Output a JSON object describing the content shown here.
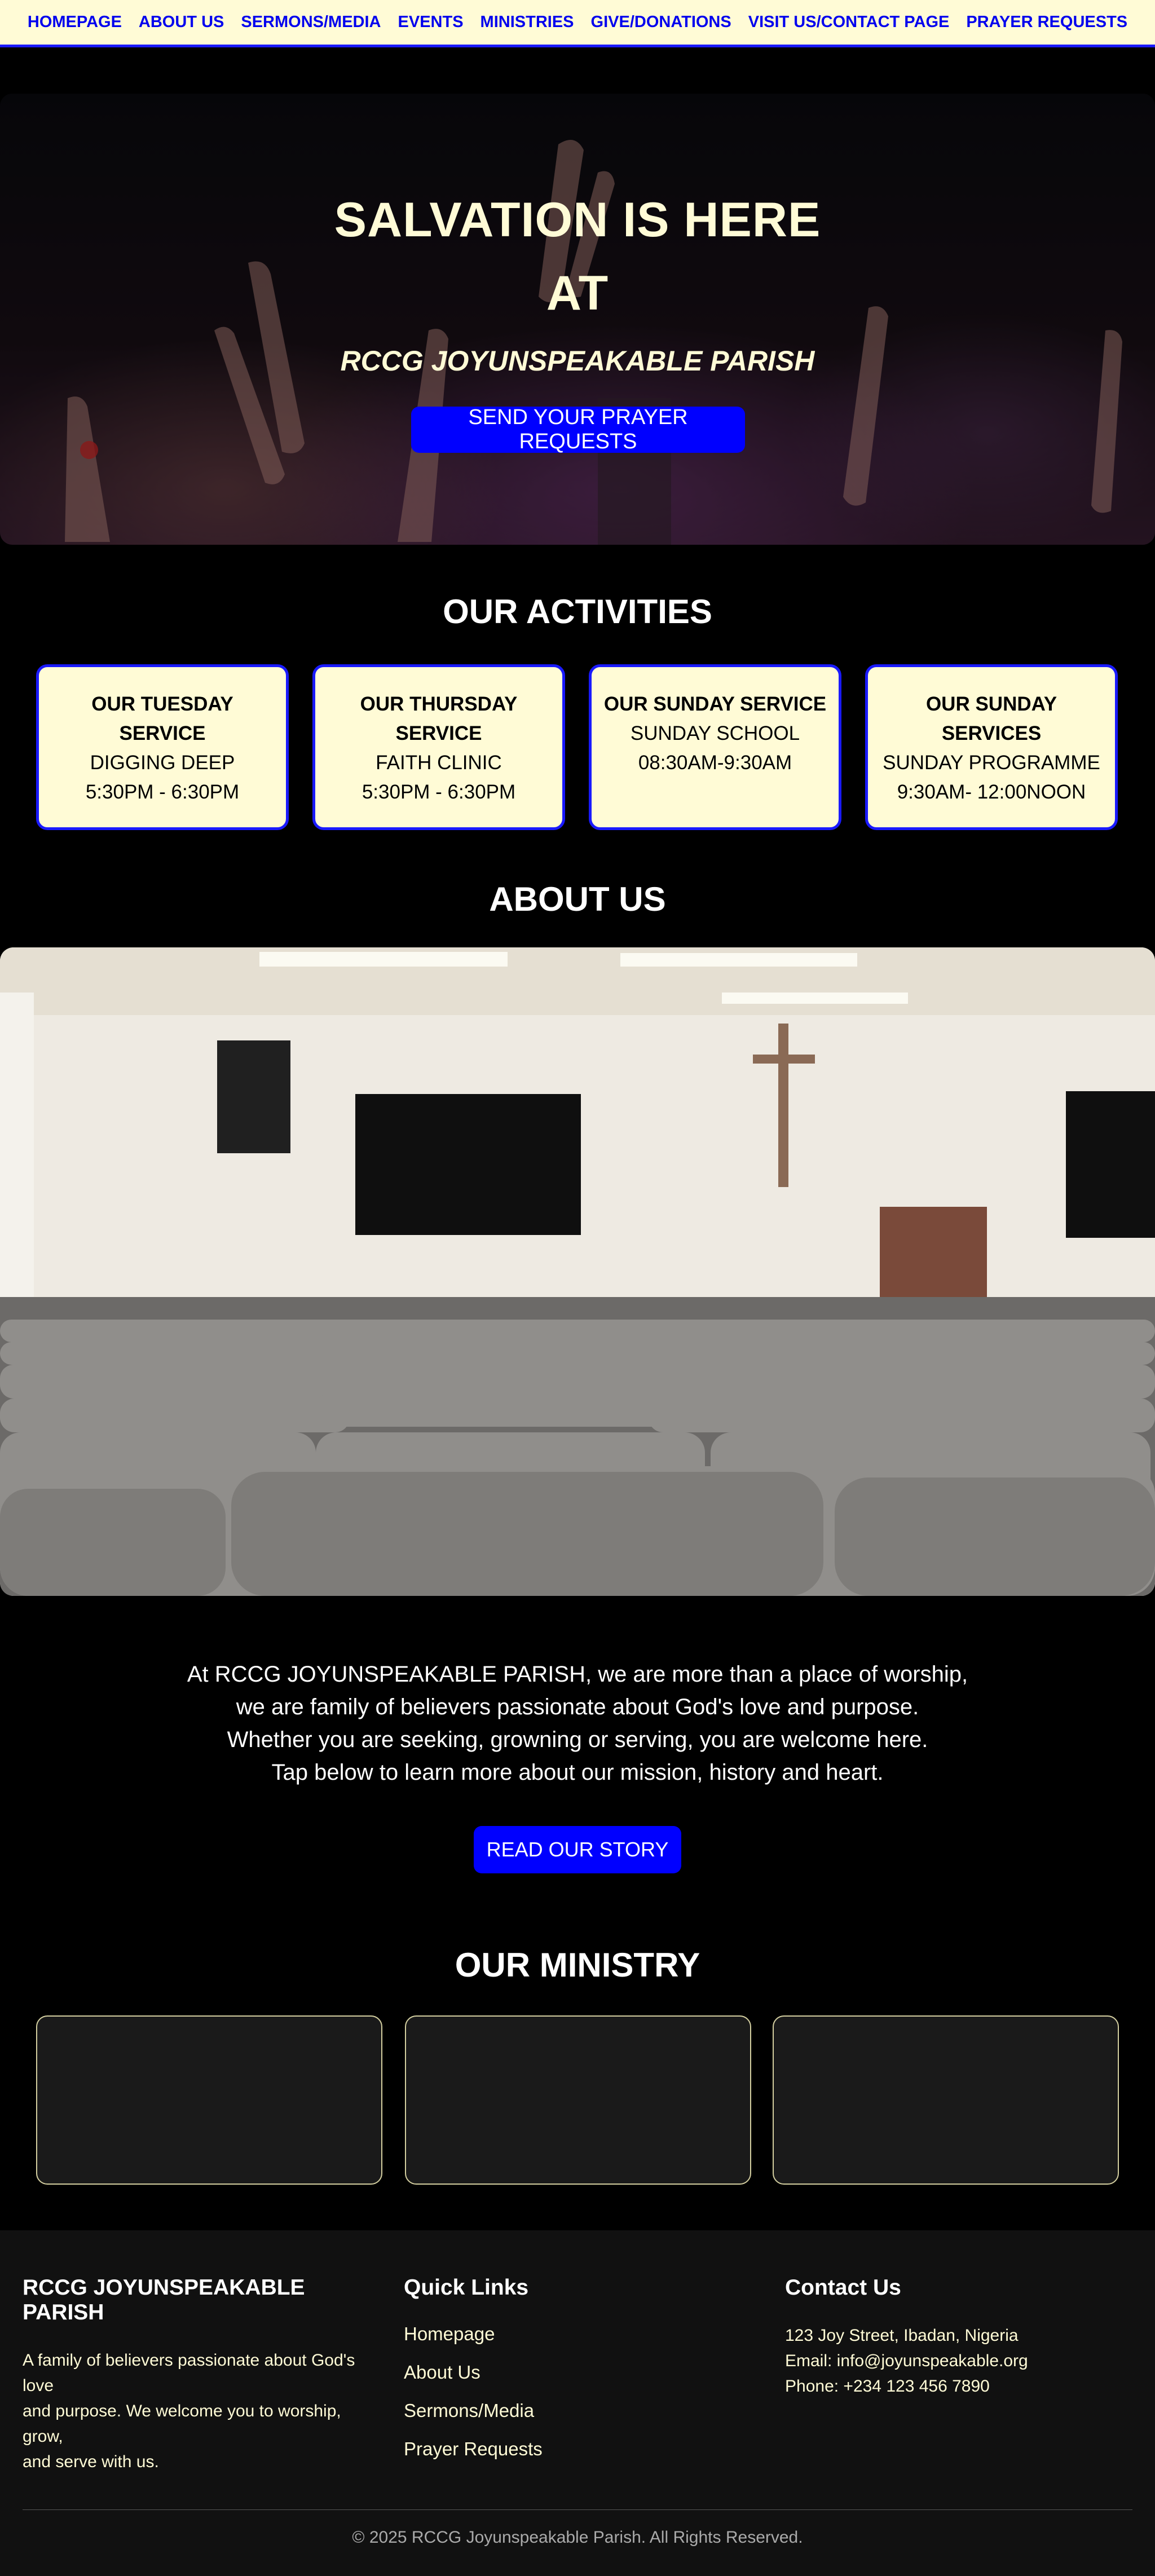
{
  "nav": {
    "items": [
      "HOMEPAGE",
      "ABOUT US",
      "SERMONS/MEDIA",
      "EVENTS",
      "MINISTRIES",
      "GIVE/DONATIONS",
      "VISIT US/CONTACT PAGE",
      "PRAYER REQUESTS"
    ]
  },
  "hero": {
    "title_line1": "SALVATION IS HERE",
    "title_line2": "AT",
    "subtitle": "RCCG JOYUNSPEAKABLE PARISH",
    "button": "SEND YOUR PRAYER REQUESTS"
  },
  "activities": {
    "title": "OUR ACTIVITIES",
    "cards": [
      {
        "heading_line1": "OUR TUESDAY",
        "heading_line2": "SERVICE",
        "name": "DIGGING DEEP",
        "time": "5:30PM - 6:30PM"
      },
      {
        "heading_line1": "OUR THURSDAY",
        "heading_line2": "SERVICE",
        "name": "FAITH CLINIC",
        "time": "5:30PM - 6:30PM"
      },
      {
        "heading_line1": "OUR SUNDAY SERVICE",
        "heading_line2": "",
        "name": "SUNDAY SCHOOL",
        "time": "08:30AM-9:30AM"
      },
      {
        "heading_line1": "OUR SUNDAY",
        "heading_line2": "SERVICES",
        "name": "SUNDAY PROGRAMME",
        "time": "9:30AM- 12:00NOON"
      }
    ]
  },
  "about": {
    "title": "ABOUT US",
    "lines": [
      "At RCCG JOYUNSPEAKABLE PARISH, we are more than a place of worship,",
      "we are family of believers passionate about God's love and purpose.",
      "Whether you are seeking, growning or serving, you are welcome here.",
      "Tap below to learn more about our mission, history and heart."
    ],
    "button": "READ OUR STORY"
  },
  "ministry": {
    "title": "OUR MINISTRY"
  },
  "footer": {
    "brand": "RCCG JOYUNSPEAKABLE PARISH",
    "description_lines": [
      "A family of believers passionate about God's love",
      "and purpose. We welcome you to worship, grow,",
      "and serve with us."
    ],
    "quick_links_title": "Quick Links",
    "quick_links": [
      "Homepage",
      "About Us",
      "Sermons/Media",
      "Prayer Requests"
    ],
    "contact_title": "Contact Us",
    "address": "123 Joy Street, Ibadan, Nigeria",
    "email": "Email: info@joyunspeakable.org",
    "phone": "Phone: +234 123 456 7890",
    "copyright": "© 2025 RCCG Joyunspeakable Parish. All Rights Reserved."
  }
}
